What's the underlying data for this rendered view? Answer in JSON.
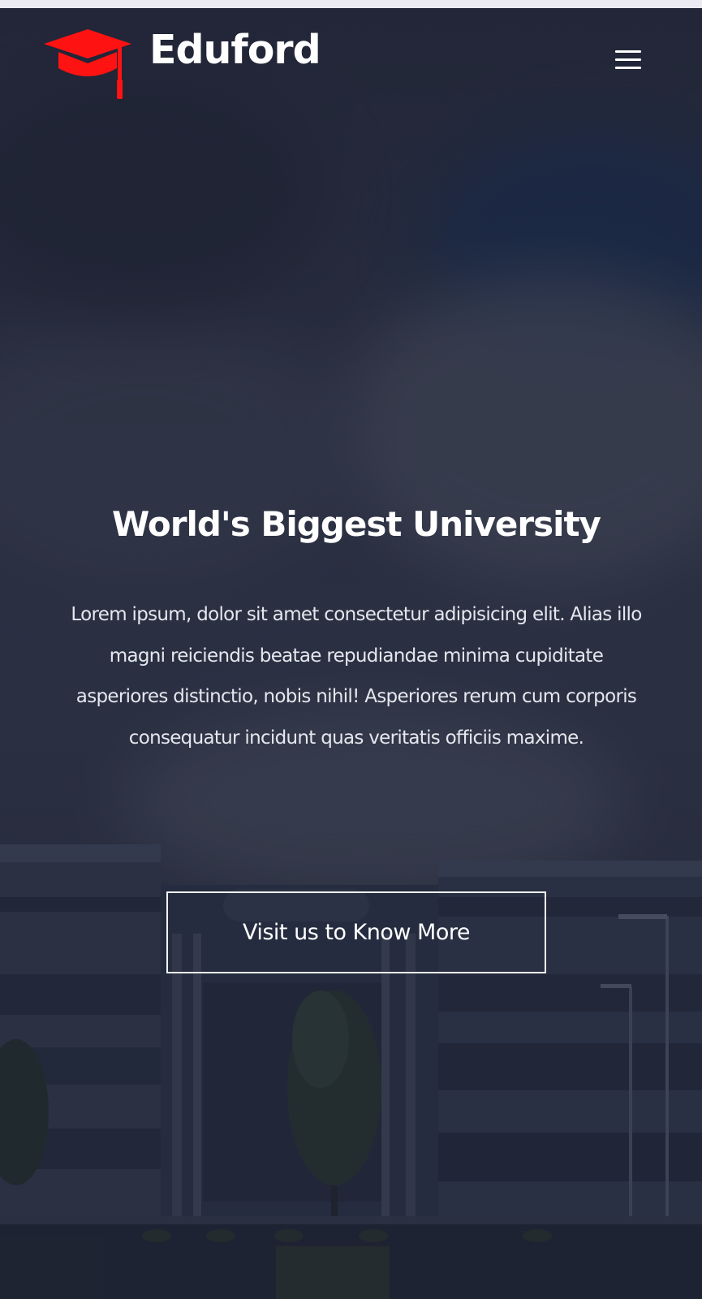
{
  "brand": {
    "name": "Eduford",
    "logo_icon": "graduation-cap-icon",
    "logo_color": "#ff1212"
  },
  "header": {
    "menu_icon": "hamburger-menu-icon"
  },
  "hero": {
    "title": "World's Biggest University",
    "description": "Lorem ipsum, dolor sit amet consectetur adipisicing elit. Alias illo magni reiciendis beatae repudiandae minima cupiditate asperiores distinctio, nobis nihil! Asperiores rerum cum corporis consequatur incidunt quas veritatis officiis maxime.",
    "cta_label": "Visit us to Know More",
    "background": "university campus building under a cloudy sky"
  },
  "colors": {
    "overlay": "#161b2d",
    "text": "#ffffff",
    "accent": "#ff1212"
  }
}
